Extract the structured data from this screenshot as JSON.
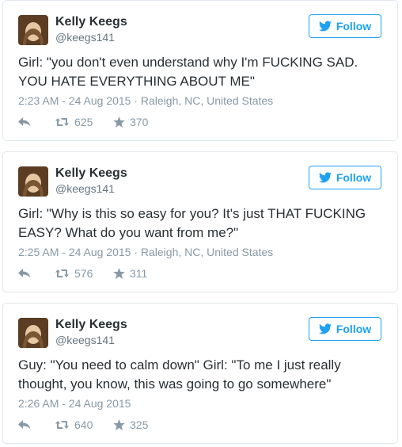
{
  "tweets": [
    {
      "name": "Kelly Keegs",
      "handle": "@keegs141",
      "follow_label": "Follow",
      "text": "Girl: \"you don't even understand why I'm FUCKING SAD. YOU HATE EVERYTHING ABOUT ME\"",
      "meta": "2:23 AM - 24 Aug 2015 · Raleigh, NC, United States",
      "retweets": "625",
      "likes": "370"
    },
    {
      "name": "Kelly Keegs",
      "handle": "@keegs141",
      "follow_label": "Follow",
      "text": "Girl: \"Why is this so easy for you? It's just THAT FUCKING EASY? What do you want from me?\"",
      "meta": "2:25 AM - 24 Aug 2015 · Raleigh, NC, United States",
      "retweets": "576",
      "likes": "311"
    },
    {
      "name": "Kelly Keegs",
      "handle": "@keegs141",
      "follow_label": "Follow",
      "text": "Guy: \"You need to calm down\" Girl: \"To me I just really thought, you know, this was going to go somewhere\"",
      "meta": "2:26 AM - 24 Aug 2015",
      "retweets": "640",
      "likes": "325"
    }
  ],
  "colors": {
    "accent": "#1da1f2",
    "text": "#292f33",
    "muted": "#8899a6",
    "border": "#e1e8ed"
  },
  "icons": [
    "avatar",
    "twitter-bird-icon",
    "reply-icon",
    "retweet-icon",
    "star-icon"
  ]
}
